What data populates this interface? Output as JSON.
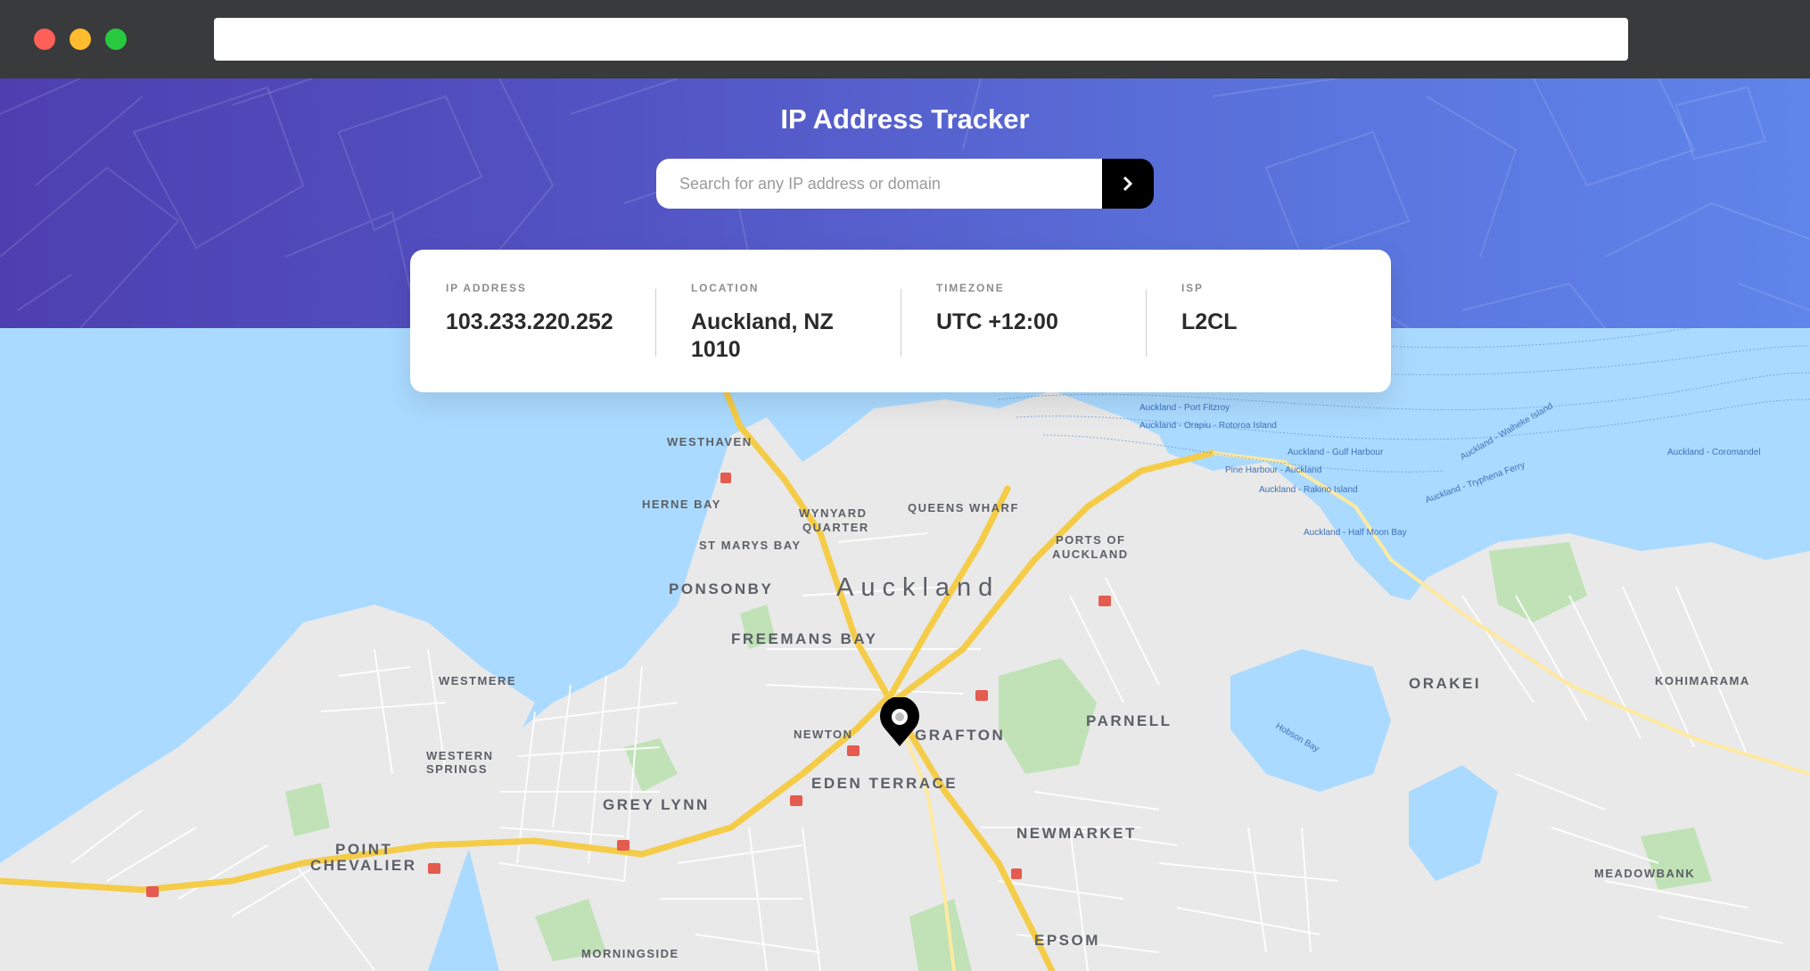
{
  "app": {
    "title": "IP Address Tracker"
  },
  "search": {
    "placeholder": "Search for any IP address or domain",
    "value": "",
    "button_icon": "chevron-right-icon"
  },
  "info": [
    {
      "label": "IP ADDRESS",
      "value": "103.233.220.252"
    },
    {
      "label": "LOCATION",
      "value": "Auckland, NZ 1010"
    },
    {
      "label": "TIMEZONE",
      "value": "UTC +12:00"
    },
    {
      "label": "ISP",
      "value": "L2CL"
    }
  ],
  "map": {
    "city_label": "Auckland",
    "marker_icon": "location-pin-icon",
    "neighborhoods": [
      "WESTHAVEN",
      "HERNE BAY",
      "WYNYARD QUARTER",
      "QUEENS WHARF",
      "ST MARYS BAY",
      "PORTS OF AUCKLAND",
      "PONSONBY",
      "FREEMANS BAY",
      "WESTMERE",
      "WESTERN SPRINGS",
      "GREY LYNN",
      "NEWTON",
      "GRAFTON",
      "PARNELL",
      "EDEN TERRACE",
      "NEWMARKET",
      "POINT CHEVALIER",
      "MORNINGSIDE",
      "EPSOM",
      "ORAKEI",
      "KOHIMARAMA",
      "MEADOWBANK"
    ],
    "ferry_routes": [
      "Auckland - Port Fitzroy",
      "Auckland - Orapiu - Rotoroa Island",
      "Auckland - Gulf Harbour",
      "Pine Harbour - Auckland",
      "Auckland - Rakino Island",
      "Auckland - Coromandel",
      "Auckland - Half Moon Bay",
      "Auckland - Tryphena Ferry",
      "Auckland - Waiheke Island"
    ],
    "water_label": "Hobson Bay",
    "colors": {
      "water": "#aadaff",
      "land": "#e8e8e8",
      "park": "#c0e2b6",
      "highway": "#f5cc48",
      "road": "#ffffff"
    }
  },
  "colors": {
    "header_gradient_start": "#4e3fb0",
    "header_gradient_end": "#5f85ea",
    "card": "#ffffff",
    "button": "#000000"
  }
}
